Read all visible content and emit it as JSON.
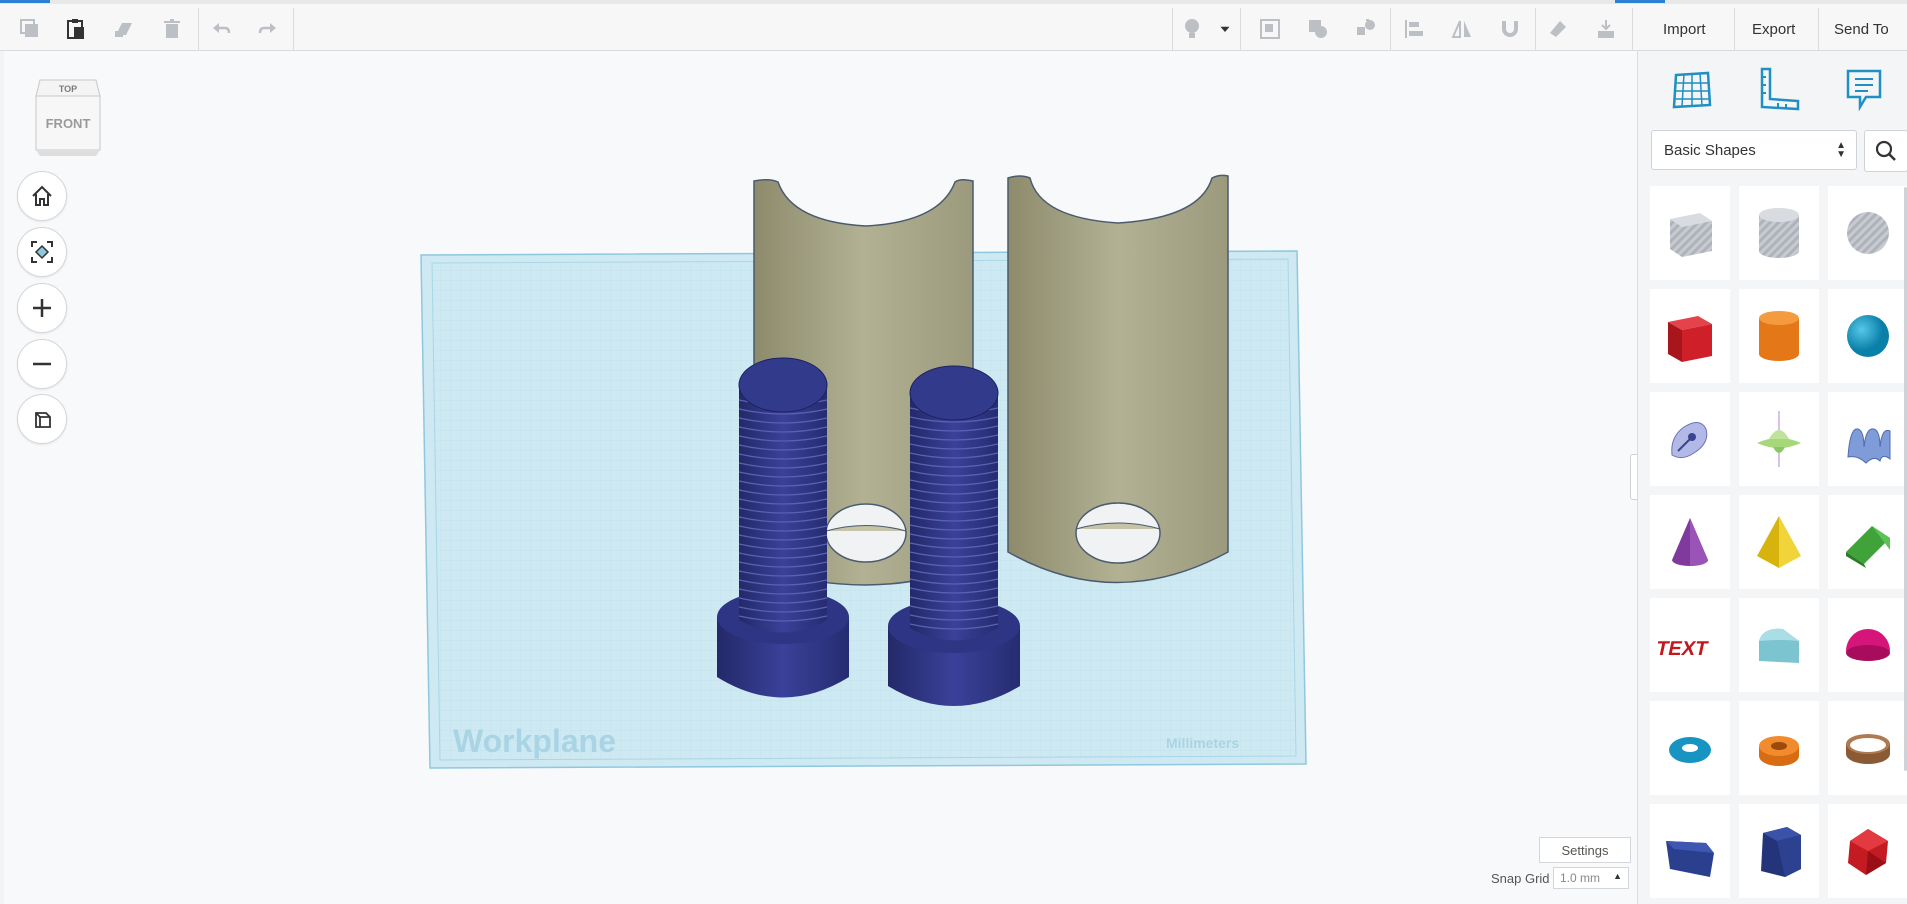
{
  "toolbar": {
    "left_icons": [
      "copy-icon",
      "paste-icon",
      "duplicate-icon",
      "delete-icon",
      "undo-icon",
      "redo-icon"
    ],
    "right_icons": [
      "light-bulb-icon",
      "dropdown-icon",
      "group-icon",
      "ungroup-icon",
      "cruise-icon",
      "align-icon",
      "mirror-icon",
      "magnet-icon",
      "paint-icon",
      "drop-icon"
    ],
    "import_label": "Import",
    "export_label": "Export",
    "send_to_label": "Send To"
  },
  "viewcube": {
    "top": "TOP",
    "front": "FRONT"
  },
  "nav_buttons": [
    "home-icon",
    "fit-view-icon",
    "zoom-in-icon",
    "zoom-out-icon",
    "perspective-icon"
  ],
  "workplane": {
    "label": "Workplane",
    "units": "Millimeters"
  },
  "sidebar": {
    "top_icons": [
      "workplane-icon",
      "ruler-icon",
      "notes-icon"
    ],
    "category": "Basic Shapes",
    "shapes": [
      "box-hole",
      "cylinder-hole",
      "sphere-hole",
      "box",
      "cylinder",
      "sphere",
      "scribble",
      "paraboloid-shape",
      "wave-shape",
      "cone",
      "pyramid",
      "roof",
      "text",
      "round-roof",
      "half-sphere",
      "torus",
      "tube",
      "ring",
      "wedge",
      "polygon",
      "icosahedron"
    ]
  },
  "settings": {
    "label": "Settings"
  },
  "snap_grid": {
    "label": "Snap Grid",
    "value": "1.0 mm"
  },
  "colors": {
    "accent": "#2d7fd3",
    "workplane": "#c9e6f1",
    "bolt": "#2f3580",
    "bracket": "#a9a78a"
  }
}
